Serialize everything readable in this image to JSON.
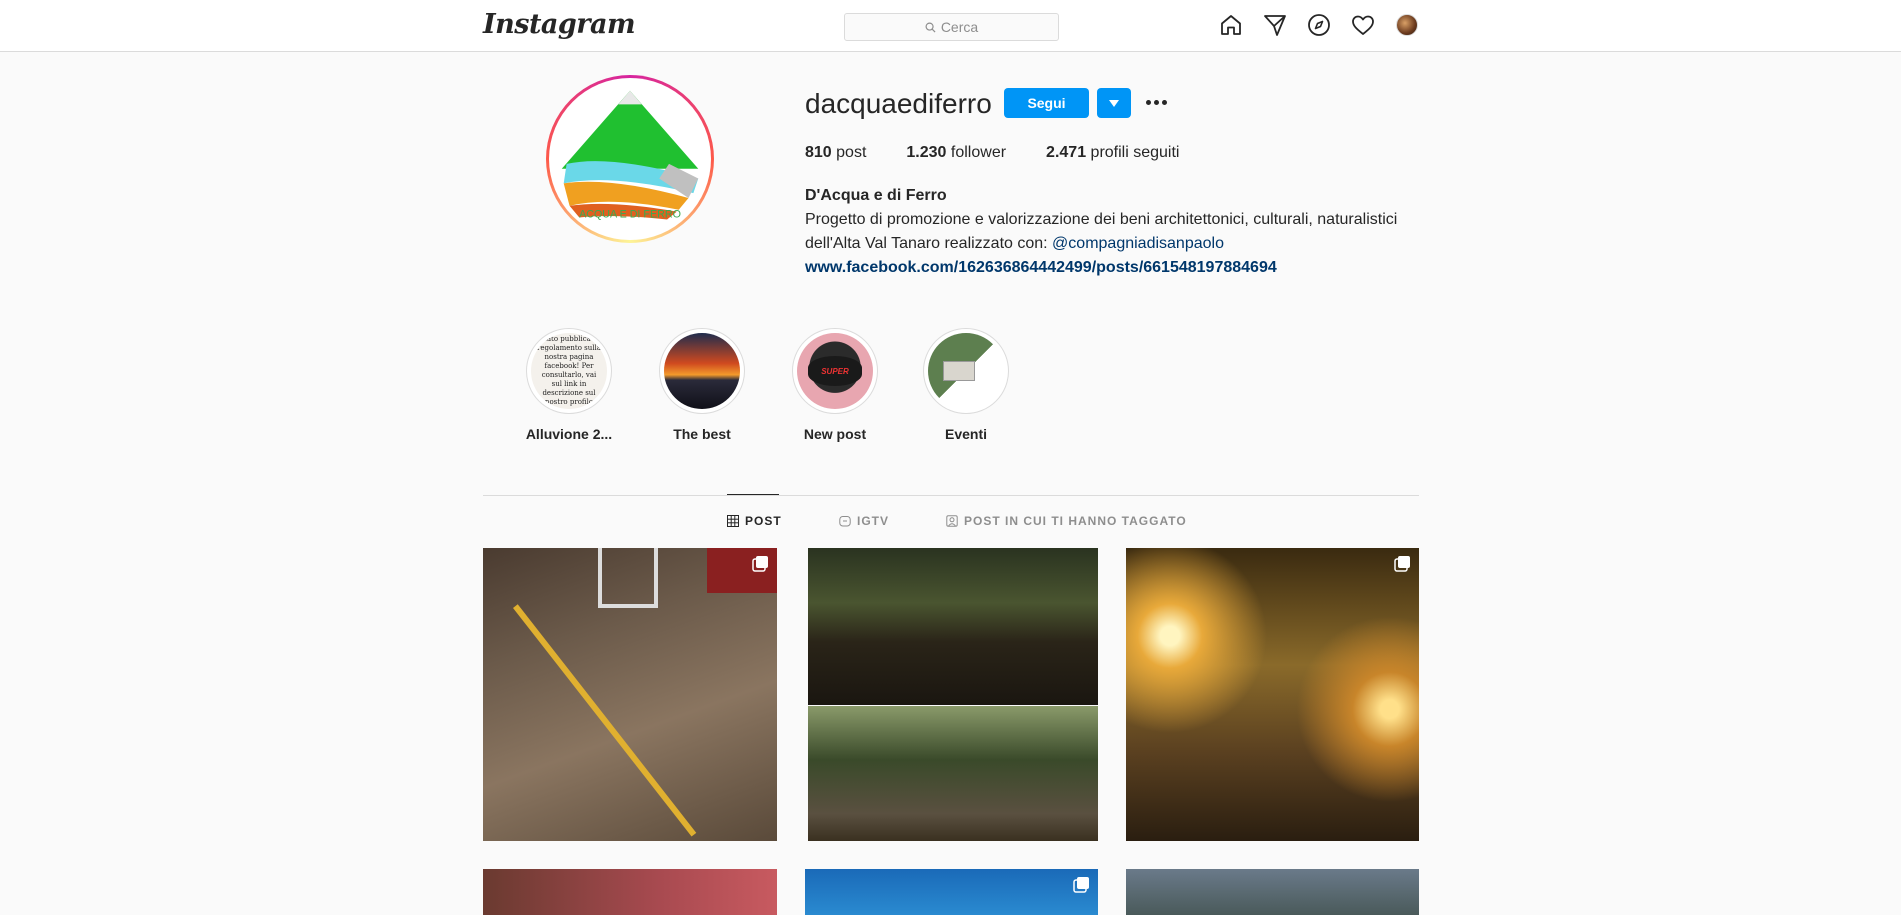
{
  "topbar": {
    "logo": "Instagram",
    "search_placeholder": "Cerca",
    "icons": [
      "home-icon",
      "direct-icon",
      "explore-icon",
      "activity-heart-icon",
      "profile-avatar"
    ]
  },
  "profile": {
    "username": "dacquaediferro",
    "follow_label": "Segui",
    "stats": {
      "posts_value": "810",
      "posts_label": "post",
      "followers_value": "1.230",
      "followers_label": "follower",
      "following_value": "2.471",
      "following_label": "profili seguiti"
    },
    "bio": {
      "full_name": "D'Acqua e di Ferro",
      "line1": "Progetto di promozione e valorizzazione dei beni architettonici, culturali, naturalistici",
      "line2_prefix": "dell'Alta Val Tanaro realizzato con: ",
      "mention": "@compagniadisanpaolo",
      "link": "www.facebook.com/162636864442499/posts/661548197884694"
    },
    "logo_text": "ACQUA E DI FERRO"
  },
  "highlights": [
    {
      "label": "Alluvione 2...",
      "cover_text": "stato pubblica il regolamento sulla nostra pagina facebook! Per consultarlo, vai sul link in descrizione sul nostro profilo"
    },
    {
      "label": "The best"
    },
    {
      "label": "New post",
      "cover_text": "SUPER"
    },
    {
      "label": "Eventi"
    }
  ],
  "tabs": [
    {
      "label": "POST",
      "active": true,
      "icon": "grid-icon"
    },
    {
      "label": "IGTV",
      "active": false,
      "icon": "igtv-icon"
    },
    {
      "label": "POST IN CUI TI HANNO TAGGATO",
      "active": false,
      "icon": "tagged-icon"
    }
  ],
  "colors": {
    "accent": "#0095f6",
    "link": "#00376b",
    "text": "#262626",
    "muted": "#8e8e8e",
    "border": "#dbdbdb",
    "background": "#fafafa"
  }
}
